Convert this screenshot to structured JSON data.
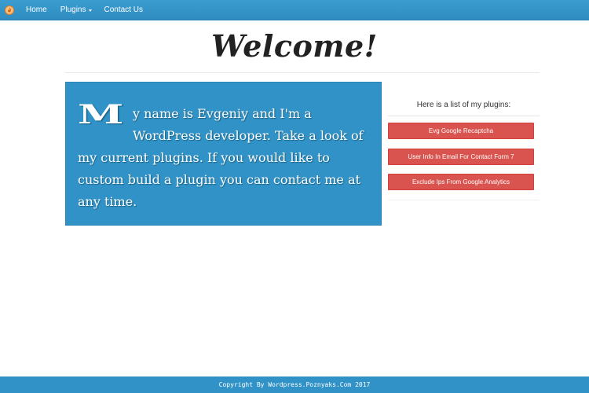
{
  "nav": {
    "logo_icon": "flame-logo-icon",
    "items": [
      {
        "label": "Home"
      },
      {
        "label": "Plugins",
        "has_dropdown": true
      },
      {
        "label": "Contact Us"
      }
    ]
  },
  "page_title": "Welcome!",
  "intro": {
    "dropcap": "M",
    "text": "y name is Evgeniy and I'm a WordPress developer. Take a look of my current plugins. If you would like to custom build a plugin you can contact me at any time."
  },
  "plugins": {
    "heading": "Here is a list of my plugins:",
    "items": [
      {
        "label": "Evg Google Recaptcha"
      },
      {
        "label": "User Info In Email For Contact Form 7"
      },
      {
        "label": "Exclude Ips From Google Analytics"
      }
    ]
  },
  "footer": {
    "text": "Copyright By Wordpress.Poznyaks.Com 2017"
  },
  "colors": {
    "nav_bg": "#3092c6",
    "intro_bg": "#3092c6",
    "button_bg": "#d9534f",
    "footer_bg": "#3092c6"
  }
}
